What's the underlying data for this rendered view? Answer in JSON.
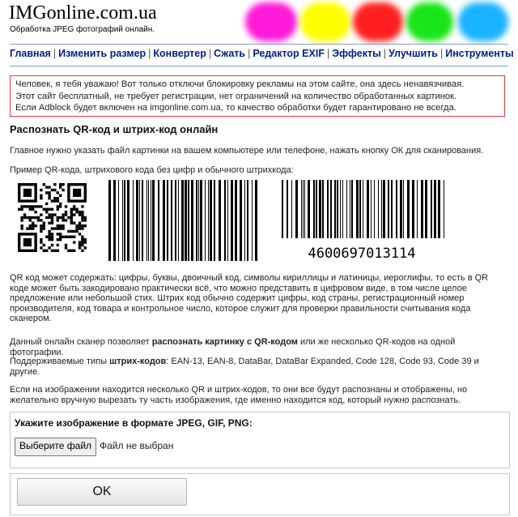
{
  "header": {
    "logo": "IMGonline.com.ua",
    "tagline": "Обработка JPEG фотографий онлайн.",
    "blob_colors": [
      "#ff1ad9",
      "#ffff00",
      "#ff1f1f",
      "#19e619",
      "#1ab3ff"
    ]
  },
  "nav": {
    "items": [
      "Главная",
      "Изменить размер",
      "Конвертер",
      "Сжать",
      "Редактор EXIF",
      "Эффекты",
      "Улучшить",
      "Инструменты"
    ],
    "separator": "|"
  },
  "notice": {
    "line1": "Человек, я тебя уважаю! Вот только отключи блокировку рекламы на этом сайте, она здесь ненавязчивая.",
    "line2": "Этот сайт бесплатный, не требует регистрации, нет ограничений на количество обработанных картинок.",
    "line3": "Если Adblock будет включен на imgonline.com.ua, то качество обработки будет гарантировано не всегда."
  },
  "main": {
    "title": "Распознать QR-код и штрих-код онлайн",
    "intro": "Главное нужно указать файл картинки на вашем компьютере или телефоне, нажать кнопку ОК для сканирования.",
    "example": "Пример QR-кода, штрихового кода без цифр и обычного штрихкода:",
    "barcode_number": "4600697013114",
    "desc": "QR код может содержать: цифры, буквы, двоичный код, символы кириллицы и латиницы, иероглифы, то есть в QR коде может быть закодировано практически всё, что можно представить в цифровом виде, в том числе целое предложение или небольшой стих. Штрих код обычно содержит цифры, код страны, регистрационный номер производителя, код товара и контрольное число, которое служит для проверки правильности считывания кода сканером.",
    "scanner_a": "Данный онлайн сканер позволяет ",
    "scanner_b": "распознать картинку с QR-кодом",
    "scanner_c": " или же несколько QR-кодов на одной фотографии.",
    "types_a": "Поддерживаемые типы ",
    "types_b": "штрих-кодов",
    "types_c": ": EAN-13, EAN-8, DataBar, DataBar Expanded, Code 128, Code 93, Code 39 и другие.",
    "multi": "Если на изображении находится несколько QR и штрих-кодов, то они все будут распознаны и отображены, но желательно вручную вырезать ту часть изображения, где именно находится код, который нужно распознать."
  },
  "form": {
    "file_label": "Укажите изображение в формате JPEG, GIF, PNG:",
    "file_button": "Выберите файл",
    "no_file": "Файл не выбран",
    "ok_button": "OK"
  }
}
